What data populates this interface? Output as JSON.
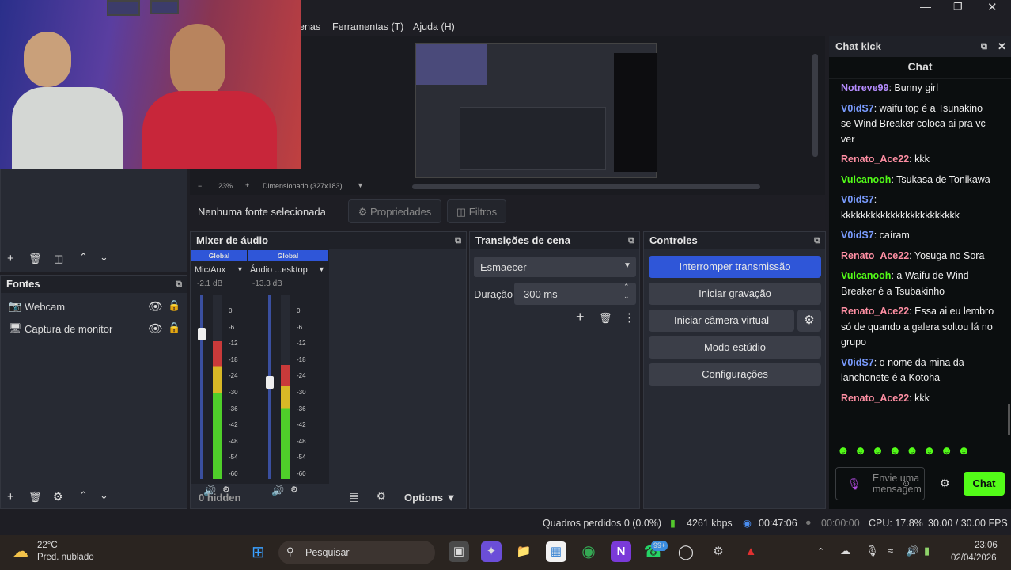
{
  "menu": {
    "partial_item": "enas",
    "tools": "Ferramentas (T)",
    "help": "Ajuda (H)"
  },
  "preview": {
    "zoom": "23%",
    "resolution": "Dimensionado (327x183)",
    "no_source": "Nenhuma fonte selecionada",
    "properties": "Propriedades",
    "filters": "Filtros"
  },
  "sources": {
    "title": "Fontes",
    "items": [
      {
        "label": "Webcam"
      },
      {
        "label": "Captura de monitor"
      }
    ]
  },
  "mixer": {
    "title": "Mixer de áudio",
    "hidden": "0 hidden",
    "options": "Options",
    "channels": [
      {
        "tag": "Global",
        "name": "Mic/Aux",
        "db": "-2.1 dB",
        "level": 0.75
      },
      {
        "tag": "Global",
        "name": "Áudio ...esktop",
        "db": "-13.3 dB",
        "level": 0.62
      }
    ],
    "scale": [
      "0",
      "-6",
      "-12",
      "-18",
      "-24",
      "-30",
      "-36",
      "-42",
      "-48",
      "-54",
      "-60"
    ]
  },
  "transitions": {
    "title": "Transições de cena",
    "selected": "Esmaecer",
    "duration_label": "Duração",
    "duration_value": "300 ms"
  },
  "controls": {
    "title": "Controles",
    "stop_stream": "Interromper transmissão",
    "start_recording": "Iniciar gravação",
    "start_virtual_cam": "Iniciar câmera virtual",
    "studio_mode": "Modo estúdio",
    "settings": "Configurações"
  },
  "chat": {
    "window_title": "Chat kick",
    "title": "Chat",
    "input_placeholder": "Envie uma mensagem",
    "send_label": "Chat",
    "messages": [
      {
        "user": "Notreve99",
        "text": "Bunny girl",
        "color": "#b58cff"
      },
      {
        "user": "V0idS7",
        "text": "waifu top é a Tsunakino se Wind Breaker coloca ai pra vc ver",
        "color": "#7a9cff"
      },
      {
        "user": "Renato_Ace22",
        "text": "kkk",
        "color": "#ff8fa3"
      },
      {
        "user": "Vulcanooh",
        "text": "Tsukasa de Tonikawa",
        "color": "#53fc18"
      },
      {
        "user": "V0idS7",
        "text": "kkkkkkkkkkkkkkkkkkkkkkkk",
        "color": "#7a9cff"
      },
      {
        "user": "V0idS7",
        "text": "caíram",
        "color": "#7a9cff"
      },
      {
        "user": "Renato_Ace22",
        "text": "Yosuga no Sora",
        "color": "#ff8fa3"
      },
      {
        "user": "Vulcanooh",
        "text": "a Waifu de Wind Breaker é a Tsubakinho",
        "color": "#53fc18"
      },
      {
        "user": "Renato_Ace22",
        "text": "Essa ai eu lembro só de quando a galera soltou lá no grupo",
        "color": "#ff8fa3"
      },
      {
        "user": "V0idS7",
        "text": "o nome da mina da lanchonete é a Kotoha",
        "color": "#7a9cff"
      },
      {
        "user": "Renato_Ace22",
        "text": "kkk",
        "color": "#ff8fa3"
      }
    ]
  },
  "status": {
    "dropped": "Quadros perdidos 0 (0.0%)",
    "bitrate": "4261 kbps",
    "stream_time": "00:47:06",
    "rec_time": "00:00:00",
    "cpu": "CPU: 17.8%",
    "fps": "30.00 / 30.00 FPS"
  },
  "taskbar": {
    "temp": "22°C",
    "weather": "Pred. nublado",
    "search": "Pesquisar",
    "whatsapp_badge": "99+",
    "time": "23:06",
    "date": "02/04/2026"
  },
  "colors": {
    "accent": "#2f56d8",
    "kick_green": "#53fc18",
    "panel": "#272a33"
  }
}
